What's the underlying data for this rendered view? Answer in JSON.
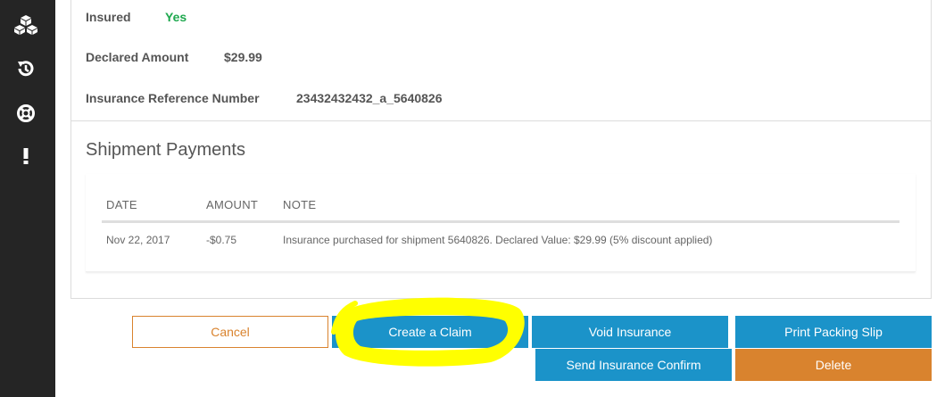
{
  "sidebar": {
    "icons": [
      {
        "name": "cubes-icon"
      },
      {
        "name": "history-icon"
      },
      {
        "name": "lifebuoy-icon"
      },
      {
        "name": "alert-icon"
      }
    ]
  },
  "insurance": {
    "insured_label": "Insured",
    "insured_value": "Yes",
    "declared_label": "Declared Amount",
    "declared_value": "$29.99",
    "reference_label": "Insurance Reference Number",
    "reference_value": "23432432432_a_5640826"
  },
  "payments": {
    "title": "Shipment Payments",
    "columns": [
      "DATE",
      "AMOUNT",
      "NOTE"
    ],
    "rows": [
      {
        "date": "Nov 22, 2017",
        "amount": "-$0.75",
        "note": "Insurance purchased for shipment 5640826. Declared Value: $29.99 (5% discount applied)"
      }
    ]
  },
  "actions": {
    "cancel": "Cancel",
    "create_claim": "Create a Claim",
    "void_insurance": "Void Insurance",
    "print_packing_slip": "Print Packing Slip",
    "send_insurance_confirm": "Send Insurance Confirm",
    "delete": "Delete"
  },
  "colors": {
    "sidebar_bg": "#252525",
    "primary_blue": "#1b93c9",
    "orange": "#d9832e",
    "success_green": "#1ea84e",
    "highlight_yellow": "#ffff00"
  }
}
